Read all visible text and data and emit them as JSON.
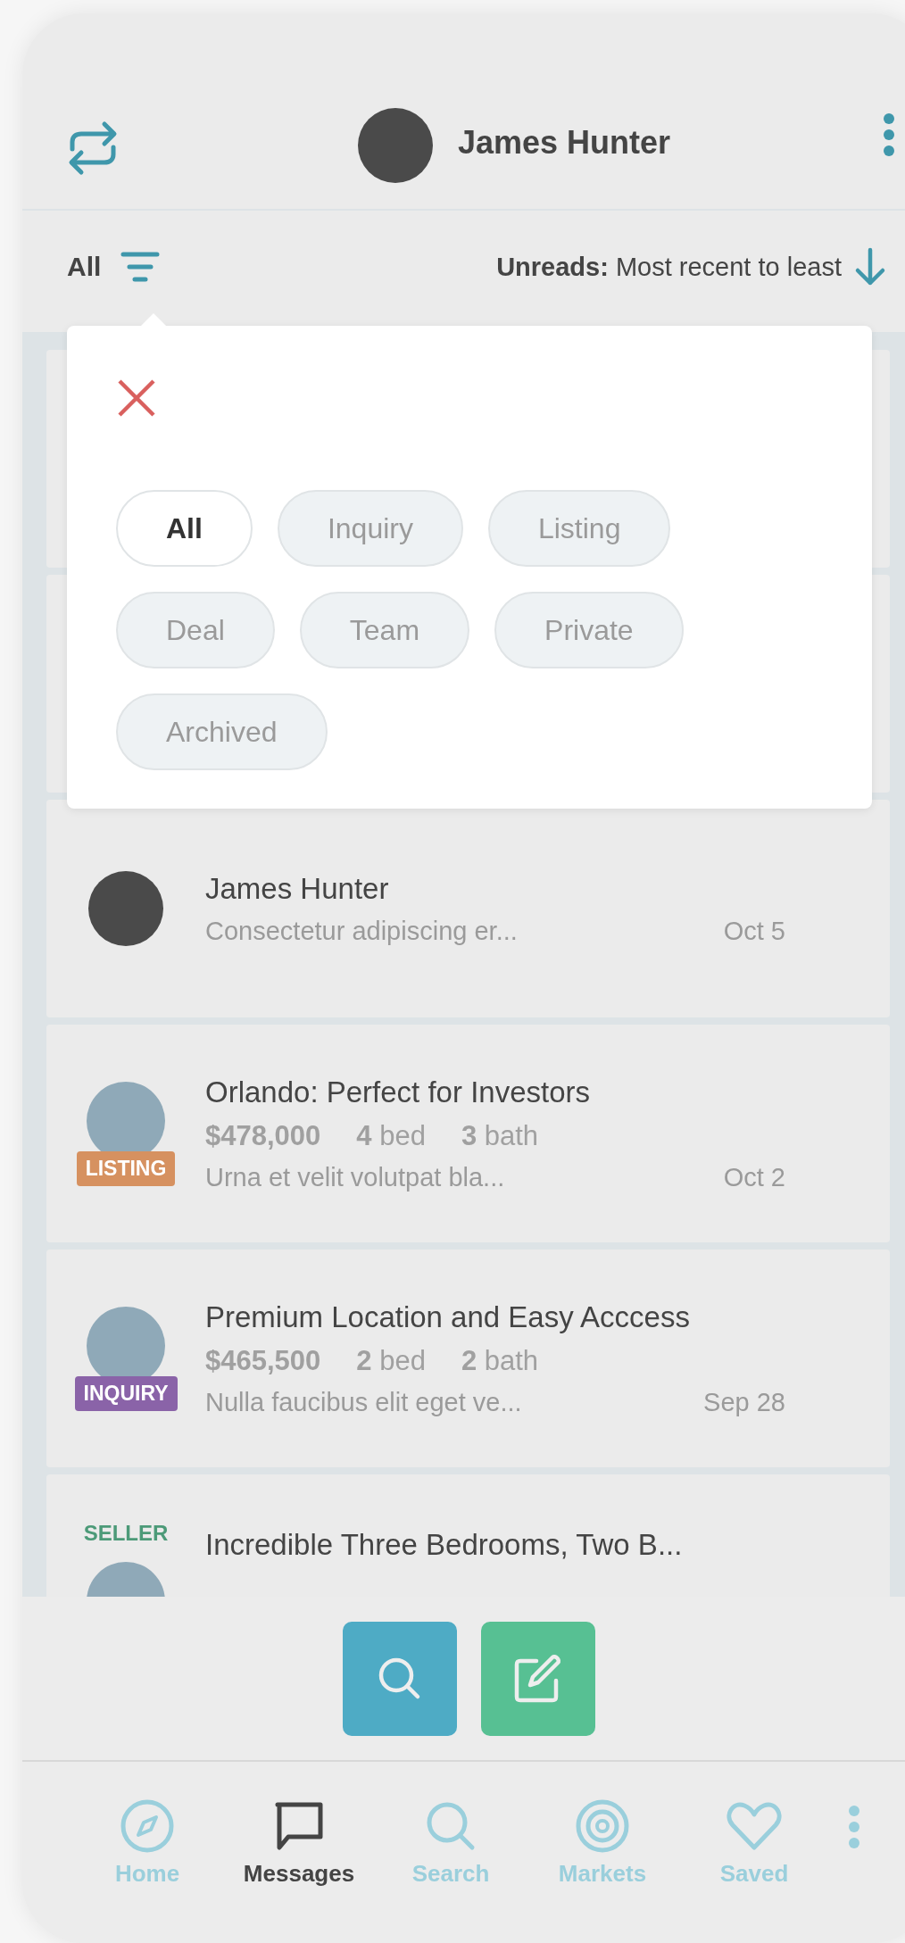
{
  "header": {
    "title": "James Hunter"
  },
  "filter_bar": {
    "filter_label": "All",
    "sort_text": "**Unreads:** Most recent to least"
  },
  "filter_popup": {
    "chips": [
      {
        "label": "All",
        "selected": true
      },
      {
        "label": "Inquiry",
        "selected": false
      },
      {
        "label": "Listing",
        "selected": false
      },
      {
        "label": "Deal",
        "selected": false
      },
      {
        "label": "Team",
        "selected": false
      },
      {
        "label": "Private",
        "selected": false
      },
      {
        "label": "Archived",
        "selected": false
      }
    ]
  },
  "conversations": [
    {
      "kind": "hidden"
    },
    {
      "kind": "hidden"
    },
    {
      "kind": "person",
      "title": "James Hunter",
      "preview": "Consectetur adipiscing er...",
      "date": "Oct 5"
    },
    {
      "kind": "property",
      "tag": {
        "kind": "badge",
        "text": "LISTING",
        "color": "#d69160"
      },
      "title": "Orlando: Perfect for Investors",
      "price": "$478,000",
      "beds": "**4** bed",
      "baths": "**3** bath",
      "preview": "Urna et velit volutpat bla...",
      "date": "Oct 2"
    },
    {
      "kind": "property",
      "tag": {
        "kind": "badge",
        "text": "INQUIRY",
        "color": "#8a63a8"
      },
      "title": "Premium Location and Easy Acccess",
      "price": "$465,500",
      "beds": "**2** bed",
      "baths": "**2** bath",
      "preview": "Nulla faucibus elit eget ve...",
      "date": "Sep 28"
    },
    {
      "kind": "property",
      "tag": {
        "kind": "label",
        "text": "SELLER",
        "color": "#4c9a78"
      },
      "title": "Incredible Three Bedrooms, Two B..."
    }
  ],
  "nav": [
    {
      "label": "Home",
      "selected": false
    },
    {
      "label": "Messages",
      "selected": true
    },
    {
      "label": "Search",
      "selected": false
    },
    {
      "label": "Markets",
      "selected": false
    },
    {
      "label": "Saved",
      "selected": false
    }
  ]
}
